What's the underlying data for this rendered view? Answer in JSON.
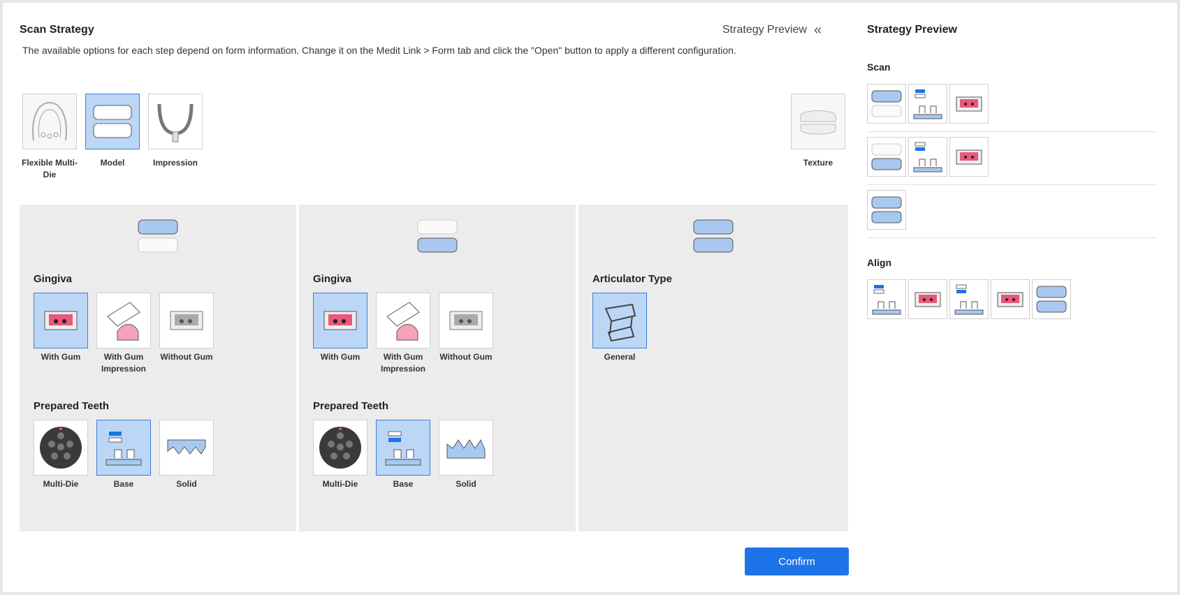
{
  "header": {
    "title": "Scan Strategy",
    "description": "The available options for each step depend on form information. Change it on the Medit Link > Form tab and click the \"Open\" button to apply a different configuration.",
    "strategy_preview_link": "Strategy Preview",
    "collapse_icon": "double-chevron-left-icon"
  },
  "modes": [
    {
      "label": "Flexible Multi-Die",
      "selected": false
    },
    {
      "label": "Model",
      "selected": true
    },
    {
      "label": "Impression",
      "selected": false
    }
  ],
  "texture": {
    "label": "Texture",
    "selected": false
  },
  "panels": {
    "upper": {
      "gingiva_title": "Gingiva",
      "gingiva": [
        {
          "label": "With Gum",
          "selected": true
        },
        {
          "label": "With Gum Impression",
          "selected": false
        },
        {
          "label": "Without Gum",
          "selected": false
        }
      ],
      "prepared_title": "Prepared Teeth",
      "prepared": [
        {
          "label": "Multi-Die",
          "selected": false
        },
        {
          "label": "Base",
          "selected": true
        },
        {
          "label": "Solid",
          "selected": false
        }
      ]
    },
    "lower": {
      "gingiva_title": "Gingiva",
      "gingiva": [
        {
          "label": "With Gum",
          "selected": true
        },
        {
          "label": "With Gum Impression",
          "selected": false
        },
        {
          "label": "Without Gum",
          "selected": false
        }
      ],
      "prepared_title": "Prepared Teeth",
      "prepared": [
        {
          "label": "Multi-Die",
          "selected": false
        },
        {
          "label": "Base",
          "selected": true
        },
        {
          "label": "Solid",
          "selected": false
        }
      ]
    },
    "occlusion": {
      "articulator_title": "Articulator Type",
      "articulator": [
        {
          "label": "General",
          "selected": true
        }
      ]
    }
  },
  "confirm_label": "Confirm",
  "preview": {
    "title": "Strategy Preview",
    "scan_title": "Scan",
    "align_title": "Align"
  },
  "colors": {
    "accent": "#1d74e8",
    "selected_bg": "#bcd6f6",
    "model_blue": "#a9c8ef",
    "gum_pink": "#e8587a",
    "panel_bg": "#ececec"
  }
}
